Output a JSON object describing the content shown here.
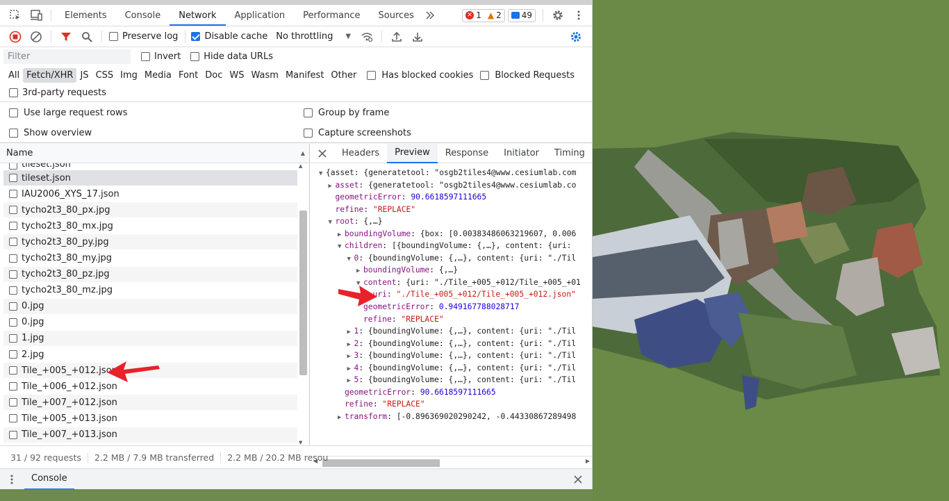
{
  "tabbar": {
    "tabs": [
      "Elements",
      "Console",
      "Network",
      "Application",
      "Performance",
      "Sources"
    ],
    "active": "Network",
    "errors": "1",
    "warnings": "2",
    "messages": "49"
  },
  "toolbar": {
    "preserve_log": "Preserve log",
    "disable_cache": "Disable cache",
    "throttling": "No throttling"
  },
  "filter": {
    "placeholder": "Filter",
    "invert": "Invert",
    "hide_data_urls": "Hide data URLs"
  },
  "types": [
    "All",
    "Fetch/XHR",
    "JS",
    "CSS",
    "Img",
    "Media",
    "Font",
    "Doc",
    "WS",
    "Wasm",
    "Manifest",
    "Other"
  ],
  "blocked": {
    "has_blocked_cookies": "Has blocked cookies",
    "blocked_requests": "Blocked Requests",
    "third_party": "3rd-party requests"
  },
  "options": {
    "large_rows": "Use large request rows",
    "group_by_frame": "Group by frame",
    "show_overview": "Show overview",
    "capture_screenshots": "Capture screenshots"
  },
  "request_list": {
    "header": "Name",
    "items": [
      "tileset.json",
      "tileset.json",
      "IAU2006_XYS_17.json",
      "tycho2t3_80_px.jpg",
      "tycho2t3_80_mx.jpg",
      "tycho2t3_80_py.jpg",
      "tycho2t3_80_my.jpg",
      "tycho2t3_80_pz.jpg",
      "tycho2t3_80_mz.jpg",
      "0.jpg",
      "0.jpg",
      "1.jpg",
      "2.jpg",
      "Tile_+005_+012.json",
      "Tile_+006_+012.json",
      "Tile_+007_+012.json",
      "Tile_+005_+013.json",
      "Tile_+007_+013.json"
    ]
  },
  "detail_tabs": [
    "Headers",
    "Preview",
    "Response",
    "Initiator",
    "Timing"
  ],
  "detail_active": "Preview",
  "preview": [
    {
      "indent": 0,
      "tri": "down",
      "parts": [
        [
          "p",
          "{asset: {generatetool: \"osgb2tiles4@www.cesiumlab.com"
        ]
      ]
    },
    {
      "indent": 1,
      "tri": "right",
      "parts": [
        [
          "k",
          "asset"
        ],
        [
          "p",
          ": {generatetool: \"osgb2tiles4@www.cesiumlab.co"
        ]
      ]
    },
    {
      "indent": 1,
      "tri": "",
      "parts": [
        [
          "k",
          "geometricError"
        ],
        [
          "p",
          ": "
        ],
        [
          "n",
          "90.6618597111665"
        ]
      ]
    },
    {
      "indent": 1,
      "tri": "",
      "parts": [
        [
          "k",
          "refine"
        ],
        [
          "p",
          ": "
        ],
        [
          "s",
          "\"REPLACE\""
        ]
      ]
    },
    {
      "indent": 1,
      "tri": "down",
      "parts": [
        [
          "k",
          "root"
        ],
        [
          "p",
          ": {,…}"
        ]
      ]
    },
    {
      "indent": 2,
      "tri": "right",
      "parts": [
        [
          "k",
          "boundingVolume"
        ],
        [
          "p",
          ": {box: [0.00383486063219607, 0.006"
        ]
      ]
    },
    {
      "indent": 2,
      "tri": "down",
      "parts": [
        [
          "k",
          "children"
        ],
        [
          "p",
          ": [{boundingVolume: {,…}, content: {uri:"
        ]
      ]
    },
    {
      "indent": 3,
      "tri": "down",
      "parts": [
        [
          "k",
          "0"
        ],
        [
          "p",
          ": {boundingVolume: {,…}, content: {uri: \"./Til"
        ]
      ]
    },
    {
      "indent": 4,
      "tri": "right",
      "parts": [
        [
          "k",
          "boundingVolume"
        ],
        [
          "p",
          ": {,…}"
        ]
      ]
    },
    {
      "indent": 4,
      "tri": "down",
      "parts": [
        [
          "k",
          "content"
        ],
        [
          "p",
          ": {uri: \"./Tile_+005_+012/Tile_+005_+01"
        ]
      ]
    },
    {
      "indent": 5,
      "tri": "",
      "parts": [
        [
          "k",
          "uri"
        ],
        [
          "p",
          ": "
        ],
        [
          "s",
          "\"./Tile_+005_+012/Tile_+005_+012.json\""
        ]
      ]
    },
    {
      "indent": 4,
      "tri": "",
      "parts": [
        [
          "k",
          "geometricError"
        ],
        [
          "p",
          ": "
        ],
        [
          "n",
          "0.949167788028717"
        ]
      ]
    },
    {
      "indent": 4,
      "tri": "",
      "parts": [
        [
          "k",
          "refine"
        ],
        [
          "p",
          ": "
        ],
        [
          "s",
          "\"REPLACE\""
        ]
      ]
    },
    {
      "indent": 3,
      "tri": "right",
      "parts": [
        [
          "k",
          "1"
        ],
        [
          "p",
          ": {boundingVolume: {,…}, content: {uri: \"./Til"
        ]
      ]
    },
    {
      "indent": 3,
      "tri": "right",
      "parts": [
        [
          "k",
          "2"
        ],
        [
          "p",
          ": {boundingVolume: {,…}, content: {uri: \"./Til"
        ]
      ]
    },
    {
      "indent": 3,
      "tri": "right",
      "parts": [
        [
          "k",
          "3"
        ],
        [
          "p",
          ": {boundingVolume: {,…}, content: {uri: \"./Til"
        ]
      ]
    },
    {
      "indent": 3,
      "tri": "right",
      "parts": [
        [
          "k",
          "4"
        ],
        [
          "p",
          ": {boundingVolume: {,…}, content: {uri: \"./Til"
        ]
      ]
    },
    {
      "indent": 3,
      "tri": "right",
      "parts": [
        [
          "k",
          "5"
        ],
        [
          "p",
          ": {boundingVolume: {,…}, content: {uri: \"./Til"
        ]
      ]
    },
    {
      "indent": 2,
      "tri": "",
      "parts": [
        [
          "k",
          "geometricError"
        ],
        [
          "p",
          ": "
        ],
        [
          "n",
          "90.6618597111665"
        ]
      ]
    },
    {
      "indent": 2,
      "tri": "",
      "parts": [
        [
          "k",
          "refine"
        ],
        [
          "p",
          ": "
        ],
        [
          "s",
          "\"REPLACE\""
        ]
      ]
    },
    {
      "indent": 2,
      "tri": "right",
      "parts": [
        [
          "k",
          "transform"
        ],
        [
          "p",
          ": [-0.896369020290242, -0.44330867289498"
        ]
      ]
    }
  ],
  "status": {
    "requests": "31 / 92 requests",
    "transferred": "2.2 MB / 7.9 MB transferred",
    "resources": "2.2 MB / 20.2 MB resou"
  },
  "drawer": {
    "console_tab": "Console"
  },
  "colors": {
    "accent": "#1a73e8",
    "annotation_arrow": "#e8212b",
    "terrain": "#6b8a48"
  }
}
